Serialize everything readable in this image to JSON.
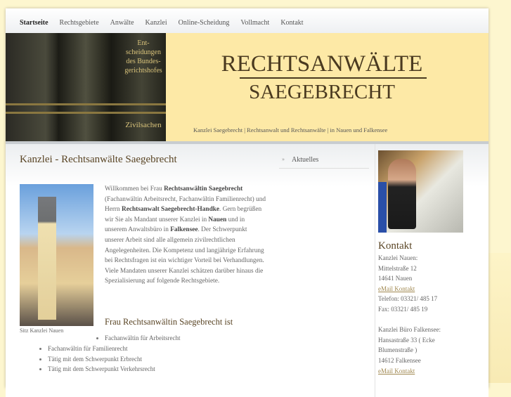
{
  "nav": [
    "Startseite",
    "Rechtsgebiete",
    "Anwälte",
    "Kanzlei",
    "Online-Scheidung",
    "Vollmacht",
    "Kontakt"
  ],
  "banner": {
    "title1": "RECHTSANWÄLTE",
    "title2": "SAEGEBRECHT",
    "tagline": "Kanzlei Saegebrecht | Rechtsanwalt und Rechtsanwälte | in Nauen und Falkensee",
    "spines": [
      "Ent-scheidungen des Bundes-gerichtshofes",
      "Zivilsachen"
    ]
  },
  "main": {
    "title": "Kanzlei - Rechtsanwälte Saegebrecht",
    "photo_caption": "Sitz Kanzlei Nauen",
    "intro": {
      "p1": "Willkommen bei Frau ",
      "b1": "Rechtsanwältin Saegebrecht",
      "p2": " (Fachanwältin Arbeitsrecht, Fachanwältin Familienrecht) und Herrn ",
      "b2": "Rechtsanwalt Saegebrecht-Handke",
      "p3": ". Gern begrüßen wir Sie als Mandant unserer Kanzlei in ",
      "b3": "Nauen",
      "p4": " und in unserem Anwaltsbüro in ",
      "b4": "Falkensee",
      "p5": ". Der Schwerpunkt unserer Arbeit sind alle allgemein zivilrechtlichen Angelegenheiten. Die Kompetenz und langjährige Erfahrung bei Rechtsfragen ist ein wichtiger Vorteil bei Verhandlungen. Viele Mandaten unserer Kanzlei schätzen darüber hinaus die Spezialisierung auf folgende Rechtsgebiete."
    },
    "subtitle": "Frau Rechtsanwältin Saegebrecht ist",
    "list": [
      "Fachanwältin für Arbeitsrecht",
      "Fachanwältin für Familienrecht",
      "Tätig mit dem Schwerpunkt Erbrecht",
      "Tätig mit dem Schwerpunkt Verkehrsrecht"
    ]
  },
  "sidebar": {
    "items": [
      "Aktuelles"
    ]
  },
  "contact": {
    "title": "Kontakt",
    "nauen": [
      "Kanzlei Nauen:",
      "Mittelstraße 12",
      "14641 Nauen"
    ],
    "email": "eMail Kontakt",
    "phone": "Telefon: 03321/ 485 17",
    "fax": "Fax: 03321/ 485 19",
    "falkensee": [
      "Kanzlei Büro Falkensee:",
      "Hansastraße 33 ( Ecke Blumenstraße )",
      "14612 Falkensee"
    ]
  }
}
